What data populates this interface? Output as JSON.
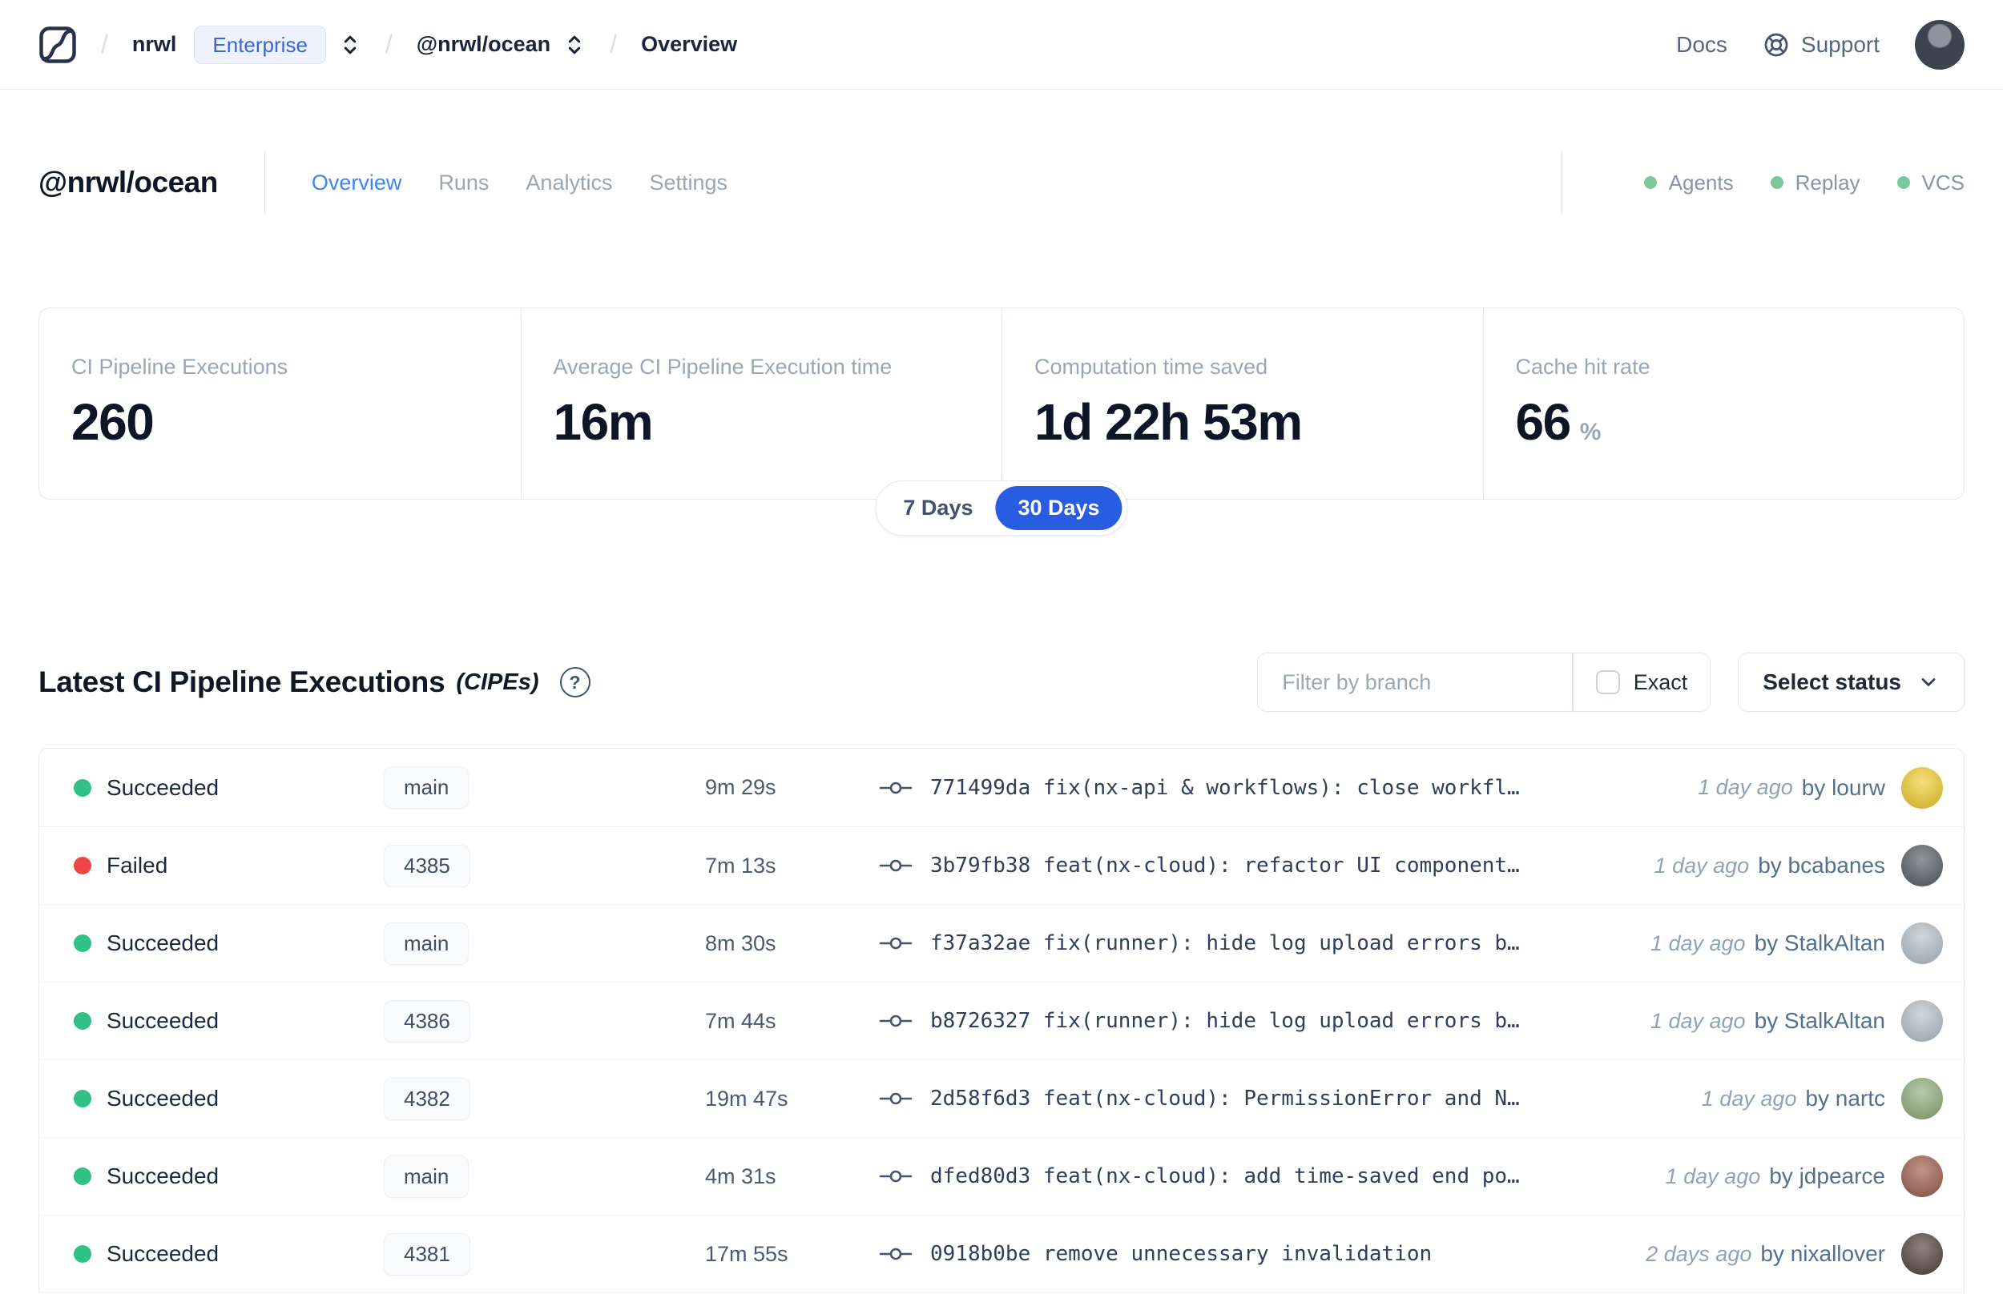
{
  "colors": {
    "accent_blue": "#2a5ce2",
    "tab_active_blue": "#3d87f5",
    "success_green": "#30c184",
    "failed_red": "#ef4444",
    "service_green": "#7cc89c"
  },
  "topbar": {
    "org": "nrwl",
    "org_badge": "Enterprise",
    "workspace": "@nrwl/ocean",
    "page": "Overview",
    "docs_label": "Docs",
    "support_label": "Support"
  },
  "workspace": {
    "title": "@nrwl/ocean",
    "tabs": [
      {
        "label": "Overview"
      },
      {
        "label": "Runs"
      },
      {
        "label": "Analytics"
      },
      {
        "label": "Settings"
      }
    ],
    "services": [
      {
        "label": "Agents"
      },
      {
        "label": "Replay"
      },
      {
        "label": "VCS"
      }
    ]
  },
  "stats": {
    "cards": [
      {
        "label": "CI Pipeline Executions",
        "value": "260",
        "unit": ""
      },
      {
        "label": "Average CI Pipeline Execution time",
        "value": "16m",
        "unit": ""
      },
      {
        "label": "Computation time saved",
        "value": "1d 22h 53m",
        "unit": ""
      },
      {
        "label": "Cache hit rate",
        "value": "66",
        "unit": "%"
      }
    ],
    "range": {
      "options": [
        "7 Days",
        "30 Days"
      ],
      "selected": "30 Days"
    }
  },
  "cipes": {
    "title": "Latest CI Pipeline Executions",
    "suffix": "(CIPEs)",
    "help_glyph": "?",
    "branch_placeholder": "Filter by branch",
    "exact_label": "Exact",
    "status_label": "Select status",
    "rows": [
      {
        "status": "Succeeded",
        "dot_color": "#30c184",
        "branch": "main",
        "duration": "9m 29s",
        "commit": "771499da fix(nx-api & workflows): close workfl…",
        "time_ago": "1 day ago",
        "author": "by lourw",
        "avatar_color": "#f2cf2e"
      },
      {
        "status": "Failed",
        "dot_color": "#ef4444",
        "branch": "4385",
        "duration": "7m 13s",
        "commit": "3b79fb38 feat(nx-cloud): refactor UI component…",
        "time_ago": "1 day ago",
        "author": "by bcabanes",
        "avatar_color": "#565d66"
      },
      {
        "status": "Succeeded",
        "dot_color": "#30c184",
        "branch": "main",
        "duration": "8m 30s",
        "commit": "f37a32ae fix(runner): hide log upload errors b…",
        "time_ago": "1 day ago",
        "author": "by StalkAltan",
        "avatar_color": "#b6c2cc"
      },
      {
        "status": "Succeeded",
        "dot_color": "#30c184",
        "branch": "4386",
        "duration": "7m 44s",
        "commit": "b8726327 fix(runner): hide log upload errors b…",
        "time_ago": "1 day ago",
        "author": "by StalkAltan",
        "avatar_color": "#b6c2cc"
      },
      {
        "status": "Succeeded",
        "dot_color": "#30c184",
        "branch": "4382",
        "duration": "19m 47s",
        "commit": "2d58f6d3 feat(nx-cloud): PermissionError and N…",
        "time_ago": "1 day ago",
        "author": "by nartc",
        "avatar_color": "#8fae79"
      },
      {
        "status": "Succeeded",
        "dot_color": "#30c184",
        "branch": "main",
        "duration": "4m 31s",
        "commit": "dfed80d3 feat(nx-cloud): add time-saved end po…",
        "time_ago": "1 day ago",
        "author": "by jdpearce",
        "avatar_color": "#9c5f4b"
      },
      {
        "status": "Succeeded",
        "dot_color": "#30c184",
        "branch": "4381",
        "duration": "17m 55s",
        "commit": "0918b0be remove unnecessary invalidation",
        "time_ago": "2 days ago",
        "author": "by nixallover",
        "avatar_color": "#55413c"
      }
    ]
  }
}
